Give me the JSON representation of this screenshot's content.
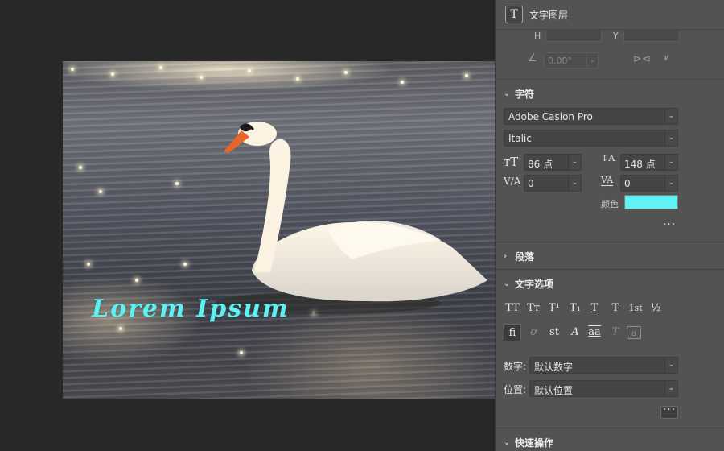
{
  "canvas": {
    "overlay_text": "Lorem Ipsum",
    "overlay_text_color": "#5ff0f2"
  },
  "panel": {
    "header_title": "文字图层",
    "layer_icon_glyph": "T",
    "transform": {
      "h_label": "H",
      "y_label": "Y",
      "angle_value": "0.00°"
    },
    "character": {
      "title": "字符",
      "font_family": "Adobe Caslon Pro",
      "font_style": "Italic",
      "font_size": "86 点",
      "leading": "148 点",
      "kerning": "0",
      "tracking": "0",
      "color_label": "颜色",
      "color_value": "#5ff3f5"
    },
    "paragraph": {
      "title": "段落"
    },
    "text_options": {
      "title": "文字选项",
      "row1": [
        "TT",
        "Tт",
        "T¹",
        "T₁",
        "T",
        "T",
        "1st",
        "½"
      ],
      "row2": [
        "ﬁ",
        "ơ",
        "st",
        "A",
        "aa",
        "T",
        "a"
      ],
      "numerals_label": "数字:",
      "numerals_value": "默认数字",
      "position_label": "位置:",
      "position_value": "默认位置"
    },
    "quick_actions": {
      "title": "快速操作"
    }
  },
  "icons": {
    "collapse": "chevron-down-icon",
    "expand": "chevron-right-icon",
    "more": "ellipsis-icon"
  }
}
